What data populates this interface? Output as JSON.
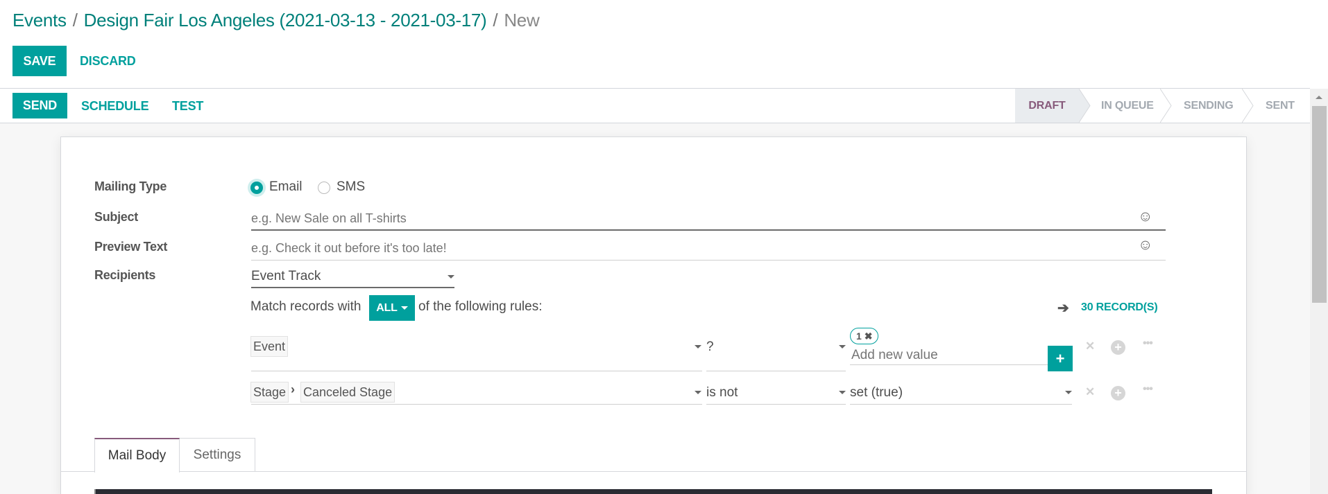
{
  "breadcrumb": {
    "items": [
      "Events",
      "Design Fair Los Angeles (2021-03-13 - 2021-03-17)"
    ],
    "separator": "/",
    "current": "New"
  },
  "control_panel": {
    "save_label": "SAVE",
    "discard_label": "DISCARD"
  },
  "header_buttons": {
    "send_label": "SEND",
    "schedule_label": "SCHEDULE",
    "test_label": "TEST"
  },
  "statusbar": {
    "stages": [
      "DRAFT",
      "IN QUEUE",
      "SENDING",
      "SENT"
    ],
    "active": "DRAFT"
  },
  "form": {
    "mailing_type": {
      "label": "Mailing Type",
      "options": [
        "Email",
        "SMS"
      ],
      "selected": "Email"
    },
    "subject": {
      "label": "Subject",
      "value": "",
      "placeholder": "e.g. New Sale on all T-shirts"
    },
    "preview_text": {
      "label": "Preview Text",
      "value": "",
      "placeholder": "e.g. Check it out before it's too late!"
    },
    "recipients": {
      "label": "Recipients",
      "value": "Event Track"
    }
  },
  "domain_editor": {
    "match_prefix": "Match records with",
    "match_mode": "ALL",
    "match_suffix": "of the following rules:",
    "record_count": "30 RECORD(S)",
    "rules": [
      {
        "field_path": [
          "Event"
        ],
        "operator": "?",
        "value_tags": [
          "1"
        ],
        "value_placeholder": "Add new value"
      },
      {
        "field_path": [
          "Stage",
          "Canceled Stage"
        ],
        "operator": "is not",
        "value": "set (true)"
      }
    ]
  },
  "tabs": {
    "items": [
      "Mail Body",
      "Settings"
    ],
    "active": "Mail Body"
  },
  "colors": {
    "primary": "#00a09d",
    "brand": "#875a7b",
    "link": "#00807a"
  }
}
